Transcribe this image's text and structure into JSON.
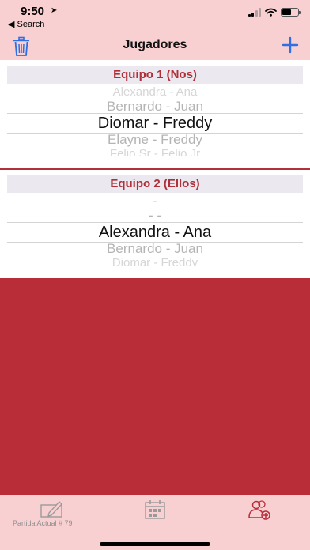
{
  "status": {
    "time": "9:50",
    "back_label": "◀ Search"
  },
  "nav": {
    "title": "Jugadores",
    "icons": {
      "left": "trash-icon",
      "right": "plus-icon"
    },
    "accent": "#2f6fe3"
  },
  "team1": {
    "header": "Equipo 1 (Nos)",
    "picker": {
      "above_far": "Alexandra - Ana",
      "above": "Bernardo - Juan",
      "selected": "Diomar - Freddy",
      "below": "Elayne - Freddy",
      "below_far": "Felio Sr - Felio Jr"
    }
  },
  "team2": {
    "header": "Equipo 2 (Ellos)",
    "picker": {
      "above_far": "-",
      "above": "- -",
      "selected": "Alexandra - Ana",
      "below": "Bernardo - Juan",
      "below_far": "Diomar - Freddy"
    }
  },
  "tabbar": {
    "footer_label": "Partida Actual # 79",
    "tabs": [
      {
        "icon": "edit-card-icon",
        "selected": false
      },
      {
        "icon": "scoreboard-calendar-icon",
        "selected": false
      },
      {
        "icon": "add-players-icon",
        "selected": true
      }
    ]
  },
  "colors": {
    "header_bg": "#f9d0d2",
    "team_title": "#b0303a",
    "red_area": "#b82d38",
    "tab_selected": "#b82d38",
    "tab_unselected": "#9a9a9a"
  }
}
